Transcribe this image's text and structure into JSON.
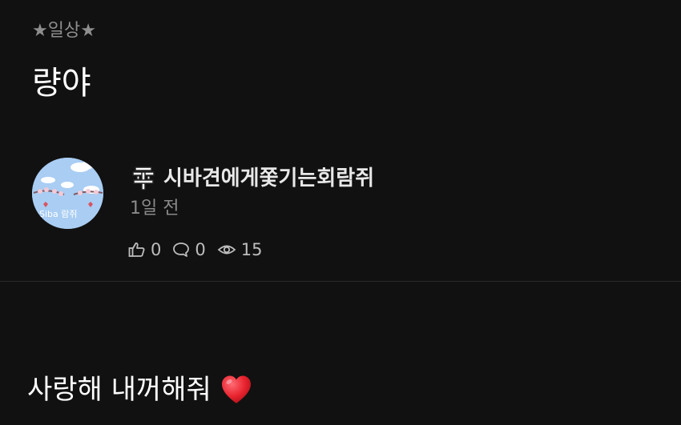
{
  "post": {
    "category": "★일상★",
    "title": "량야",
    "body": "사랑해 내꺼해줘",
    "body_emoji": "heart-icon"
  },
  "author": {
    "name": "시바견에게쫓기는회람쥐",
    "avatar_text": "Siba 람쥐",
    "level_badge_icon": "level-badge-icon",
    "time": "1일 전"
  },
  "stats": {
    "likes": "0",
    "comments": "0",
    "views": "15"
  },
  "colors": {
    "background": "#111111",
    "muted_text": "#8e8e8e",
    "heart": "#e8242f",
    "avatar_bg": "#a9cdf3"
  }
}
